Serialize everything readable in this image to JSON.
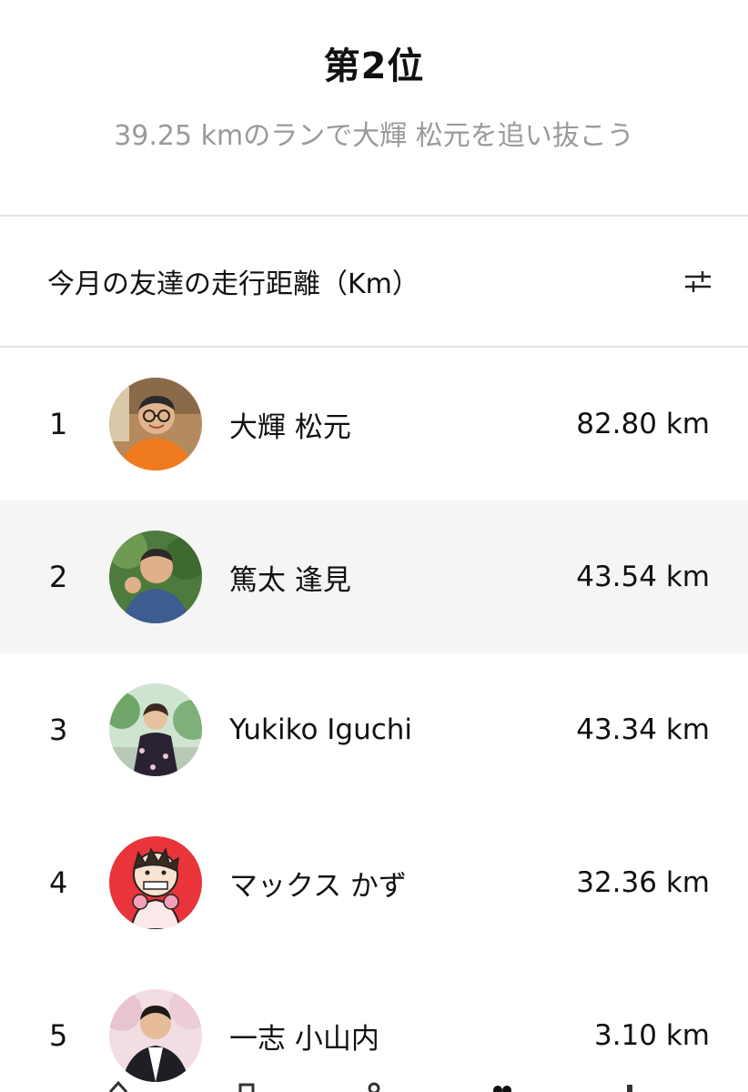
{
  "rank_header": {
    "title": "第2位",
    "subtitle": "39.25 kmのランで大輝 松元を追い抜こう"
  },
  "section": {
    "title": "今月の友達の走行距離（Km）",
    "filter_icon": "sliders-icon"
  },
  "leaderboard": [
    {
      "rank": "1",
      "name": "大輝 松元",
      "distance": "82.80 km",
      "highlighted": false
    },
    {
      "rank": "2",
      "name": "篤太 逢見",
      "distance": "43.54 km",
      "highlighted": true
    },
    {
      "rank": "3",
      "name": "Yukiko Iguchi",
      "distance": "43.34 km",
      "highlighted": false
    },
    {
      "rank": "4",
      "name": "マックス かず",
      "distance": "32.36 km",
      "highlighted": false
    },
    {
      "rank": "5",
      "name": "一志 小山内",
      "distance": "3.10 km",
      "highlighted": false
    }
  ],
  "bottom_nav": {
    "items": [
      "home-icon",
      "calendar-icon",
      "run-icon",
      "friends-icon",
      "profile-icon"
    ]
  },
  "colors": {
    "highlight_row": "#f5f5f5",
    "subtitle": "#9a9a9a",
    "divider": "#e3e3e3"
  }
}
